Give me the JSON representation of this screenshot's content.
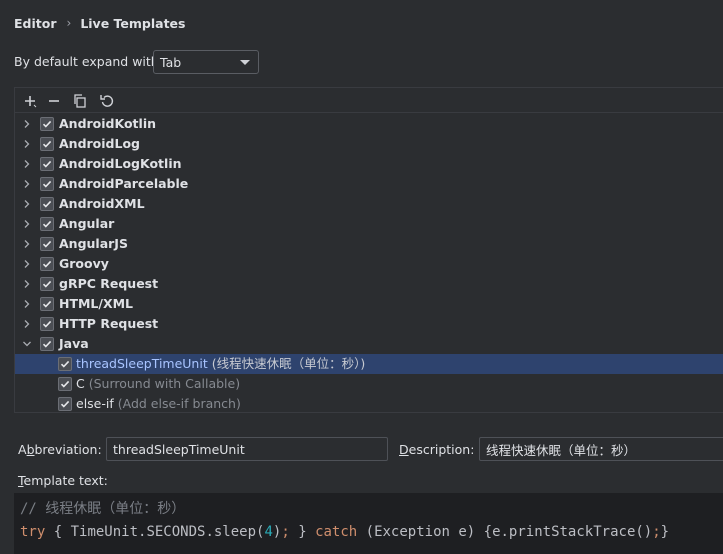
{
  "breadcrumb": {
    "parent": "Editor",
    "current": "Live Templates"
  },
  "expand": {
    "label": "By default expand with",
    "value": "Tab"
  },
  "toolbar": {
    "icons": [
      "add-icon",
      "remove-icon",
      "copy-icon",
      "undo-icon"
    ]
  },
  "groups": [
    {
      "name": "AndroidKotlin",
      "checked": true,
      "expanded": false
    },
    {
      "name": "AndroidLog",
      "checked": true,
      "expanded": false
    },
    {
      "name": "AndroidLogKotlin",
      "checked": true,
      "expanded": false
    },
    {
      "name": "AndroidParcelable",
      "checked": true,
      "expanded": false
    },
    {
      "name": "AndroidXML",
      "checked": true,
      "expanded": false
    },
    {
      "name": "Angular",
      "checked": true,
      "expanded": false
    },
    {
      "name": "AngularJS",
      "checked": true,
      "expanded": false
    },
    {
      "name": "Groovy",
      "checked": true,
      "expanded": false
    },
    {
      "name": "gRPC Request",
      "checked": true,
      "expanded": false
    },
    {
      "name": "HTML/XML",
      "checked": true,
      "expanded": false
    },
    {
      "name": "HTTP Request",
      "checked": true,
      "expanded": false
    },
    {
      "name": "Java",
      "checked": true,
      "expanded": true
    }
  ],
  "java_templates": [
    {
      "name": "threadSleepTimeUnit",
      "desc": " (线程快速休眠（单位：秒）)",
      "checked": true,
      "selected": true
    },
    {
      "name": "C",
      "desc": " (Surround with Callable)",
      "checked": true,
      "selected": false
    },
    {
      "name": "else-if",
      "desc": " (Add else-if branch)",
      "checked": true,
      "selected": false
    }
  ],
  "form": {
    "abbreviation_label_mnemonic": "b",
    "abbreviation_label_pre": "A",
    "abbreviation_label_post": "breviation:",
    "abbreviation_value": "threadSleepTimeUnit",
    "description_label_mnemonic": "D",
    "description_label_post": "escription:",
    "description_value": "线程快速休眠（单位：秒）",
    "template_text_label_mnemonic": "T",
    "template_text_label_post": "emplate text:"
  },
  "editor": {
    "line1": "// 线程休眠（单位：秒）",
    "line2": {
      "kw_try": "try",
      "part1": " { TimeUnit.SECONDS.sleep(",
      "num": "4",
      "part2": ")",
      "semi1": ";",
      "part3": " } ",
      "kw_catch": "catch",
      "part4": " (Exception e) {e.printStackTrace()",
      "semi2": ";",
      "part5": "}"
    }
  },
  "colors": {
    "selection": "#2e436e",
    "keyword": "#cf8e6d",
    "number": "#2aacb8",
    "comment": "#7a7e85"
  }
}
